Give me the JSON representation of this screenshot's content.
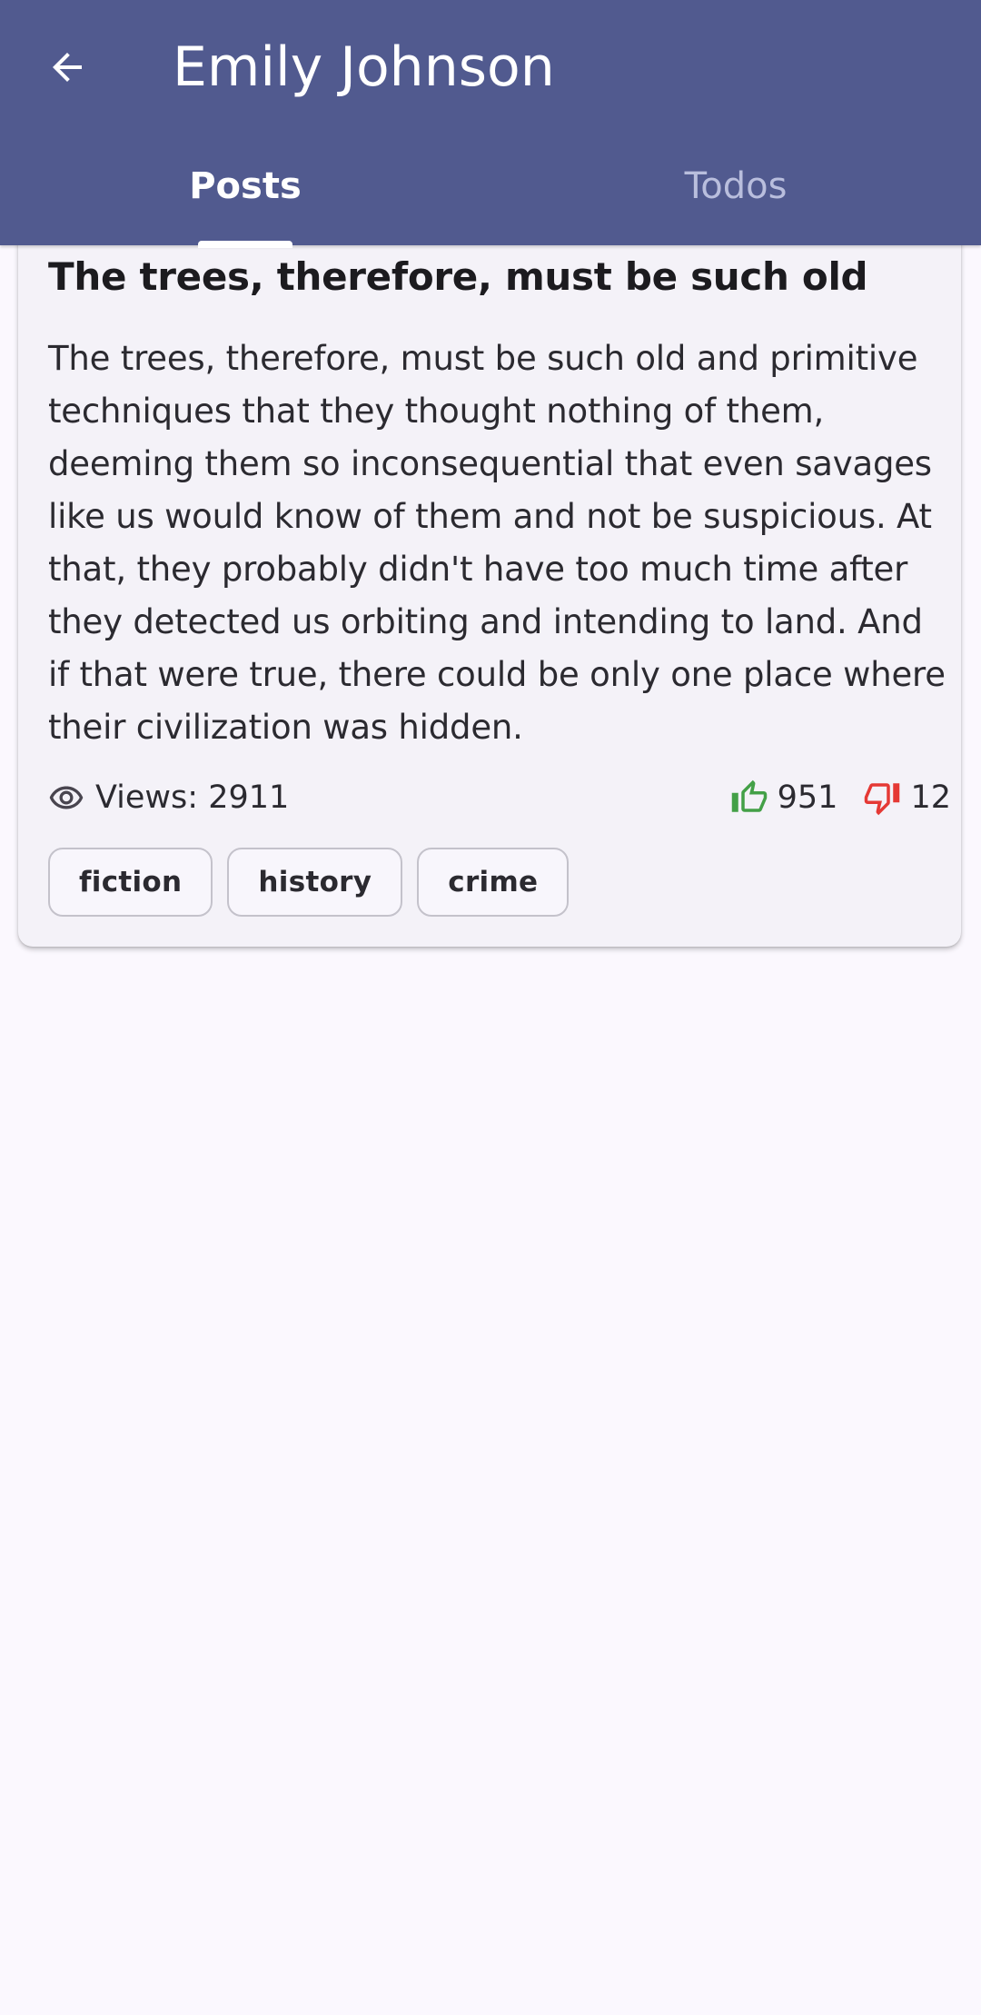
{
  "appbar": {
    "title": "Emily Johnson",
    "back_icon": "arrow-back-icon",
    "color": "#515a8f"
  },
  "tabs": [
    {
      "label": "Posts",
      "active": true
    },
    {
      "label": "Todos",
      "active": false
    }
  ],
  "post": {
    "title": "The trees, therefore, must be such old",
    "body": "The trees, therefore, must be such old and primitive techniques that they thought nothing of them, deeming them so inconsequential that even savages like us would know of them and not be suspicious. At that, they probably didn't have too much time after they detected us orbiting and intending to land. And if that were true, there could be only one place where their civilization was hidden.",
    "views_text": "Views: 2911",
    "likes": "951",
    "dislikes": "12",
    "like_color": "#43a047",
    "dislike_color": "#e53935",
    "tags": [
      "fiction",
      "history",
      "crime"
    ]
  }
}
